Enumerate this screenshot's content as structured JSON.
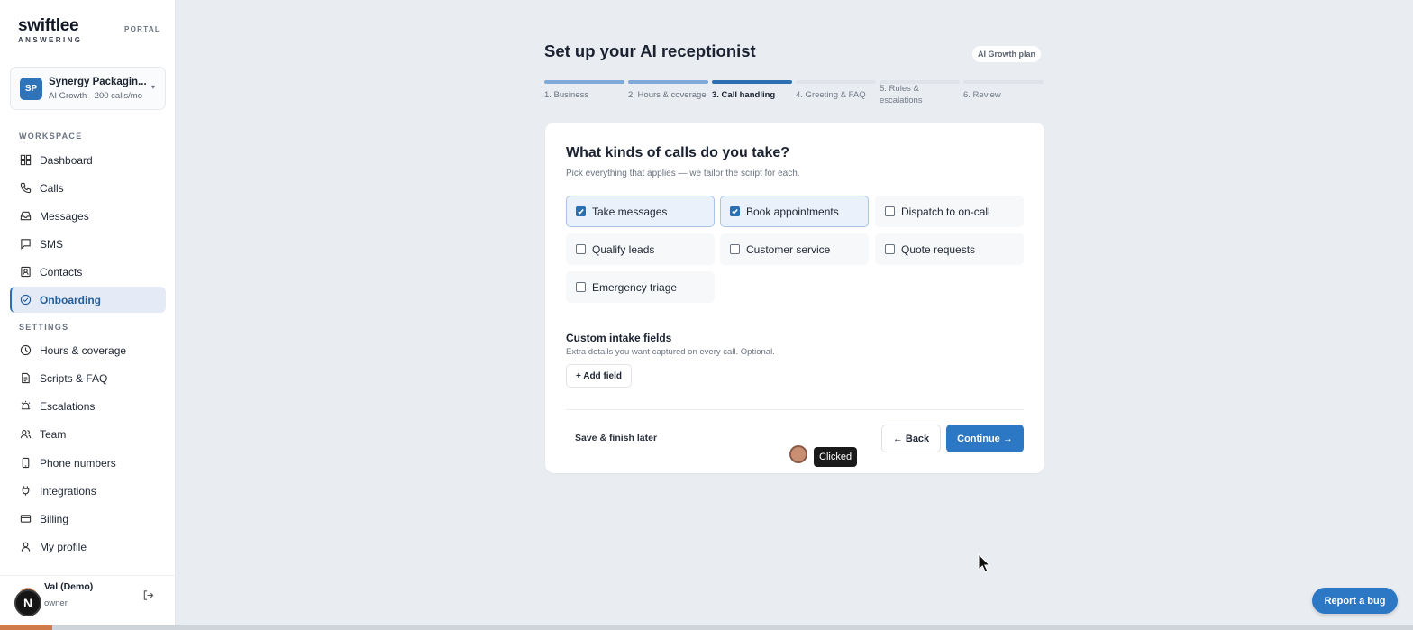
{
  "brand": {
    "name": "swiftlee",
    "sub": "ANSWERING",
    "portal": "PORTAL"
  },
  "account": {
    "initials": "SP",
    "name": "Synergy Packagin...",
    "plan": "AI Growth · 200 calls/mo"
  },
  "sidebar": {
    "workspace_label": "WORKSPACE",
    "settings_label": "SETTINGS",
    "workspace": [
      {
        "label": "Dashboard",
        "icon": "grid-icon"
      },
      {
        "label": "Calls",
        "icon": "phone-icon"
      },
      {
        "label": "Messages",
        "icon": "inbox-icon"
      },
      {
        "label": "SMS",
        "icon": "chat-icon"
      },
      {
        "label": "Contacts",
        "icon": "contact-card-icon"
      },
      {
        "label": "Onboarding",
        "icon": "check-circle-icon",
        "active": true
      }
    ],
    "settings": [
      {
        "label": "Hours & coverage",
        "icon": "clock-icon"
      },
      {
        "label": "Scripts & FAQ",
        "icon": "document-icon"
      },
      {
        "label": "Escalations",
        "icon": "alert-icon"
      },
      {
        "label": "Team",
        "icon": "users-icon"
      },
      {
        "label": "Phone numbers",
        "icon": "mobile-icon"
      },
      {
        "label": "Integrations",
        "icon": "plug-icon"
      },
      {
        "label": "Billing",
        "icon": "credit-card-icon"
      },
      {
        "label": "My profile",
        "icon": "user-icon"
      }
    ]
  },
  "user": {
    "name": "Val (Demo)",
    "role": "owner",
    "badge": "N"
  },
  "main": {
    "title": "Set up your AI receptionist",
    "plan_badge": "AI Growth plan",
    "steps": [
      {
        "label": "1. Business",
        "state": "done"
      },
      {
        "label": "2. Hours & coverage",
        "state": "done"
      },
      {
        "label": "3. Call handling",
        "state": "current"
      },
      {
        "label": "4. Greeting & FAQ",
        "state": "todo"
      },
      {
        "label": "5. Rules &\nescalations",
        "label_line1": "5. Rules &",
        "label_line2": "escalations",
        "state": "todo"
      },
      {
        "label": "6. Review",
        "state": "todo"
      }
    ],
    "question": "What kinds of calls do you take?",
    "question_sub": "Pick everything that applies — we tailor the script for each.",
    "options": [
      {
        "label": "Take messages",
        "checked": true
      },
      {
        "label": "Book appointments",
        "checked": true
      },
      {
        "label": "Dispatch to on-call",
        "checked": false
      },
      {
        "label": "Qualify leads",
        "checked": false
      },
      {
        "label": "Customer service",
        "checked": false
      },
      {
        "label": "Quote requests",
        "checked": false
      },
      {
        "label": "Emergency triage",
        "checked": false
      }
    ],
    "custom_fields_title": "Custom intake fields",
    "custom_fields_sub": "Extra details you want captured on every call. Optional.",
    "add_field": "+ Add field",
    "save_later": "Save & finish later",
    "back": "← Back",
    "continue": "Continue →"
  },
  "overlay": {
    "tooltip": "Clicked"
  },
  "report_bug": "Report a bug",
  "colors": {
    "accent": "#2c78c4",
    "active_nav_bg": "#e4eaf6",
    "progress_done": "#7fa9d6"
  }
}
